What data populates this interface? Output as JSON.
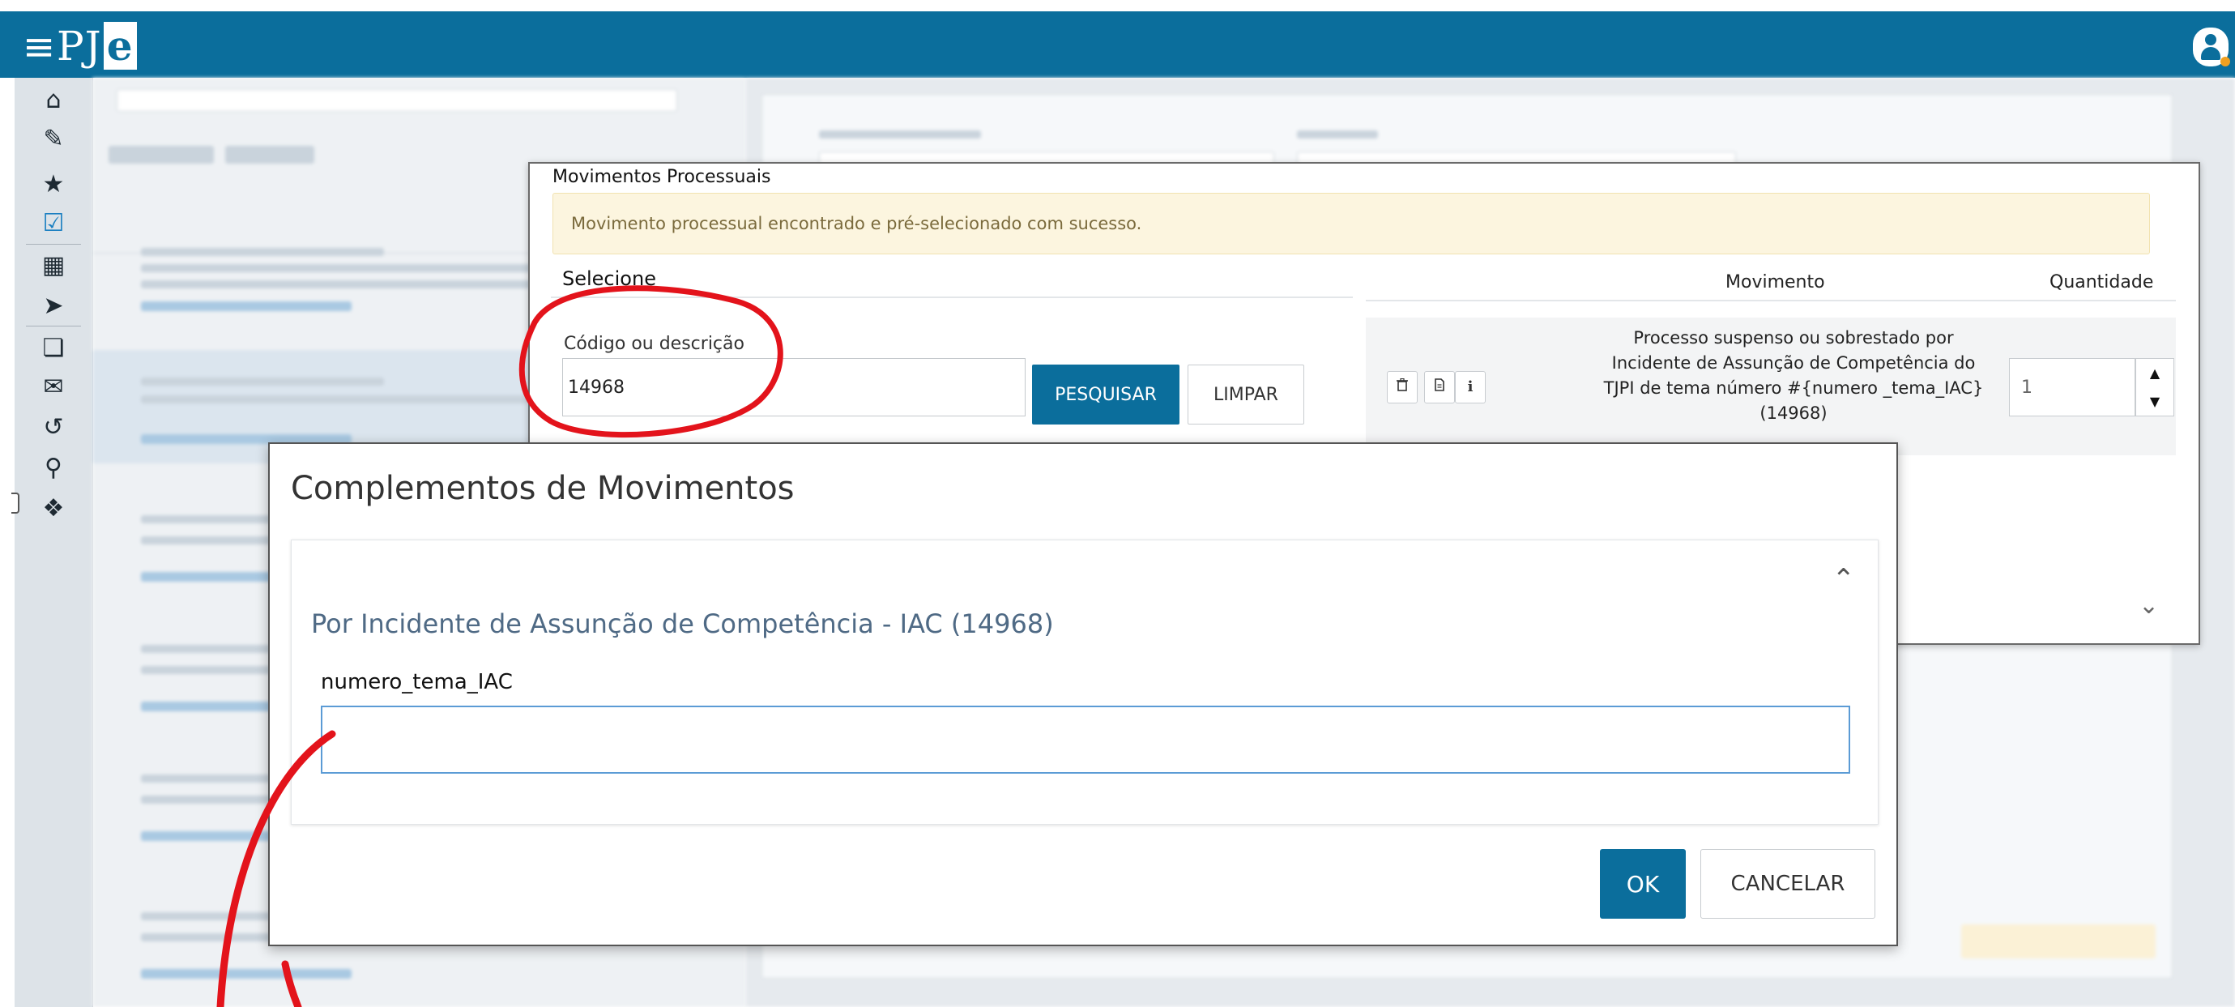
{
  "topbar": {
    "menu_icon": "hamburger-icon",
    "logo_text": "PJ",
    "logo_accent": "e",
    "user_icon": "user-icon"
  },
  "rail": {
    "icons": [
      "home-icon",
      "pencil-icon",
      "star-icon",
      "checkbox-icon",
      "calendar-icon",
      "tag-icon",
      "documents-icon",
      "envelope-icon",
      "history-icon",
      "search-icon",
      "diamond-nav-icon"
    ]
  },
  "movimentos": {
    "title": "Movimentos Processuais",
    "alert": "Movimento processual encontrado e pré-selecionado com sucesso.",
    "select_label": "Selecione",
    "code_label": "Código ou descrição",
    "code_value": "14968",
    "search_label": "PESQUISAR",
    "clear_label": "LIMPAR",
    "col_movimento": "Movimento",
    "col_quantidade": "Quantidade",
    "row": {
      "description": "Processo suspenso ou sobrestado por Incidente de Assunção de Competência do TJPI de tema número #{numero _tema_IAC} (14968)",
      "quantity": "1",
      "info_label": "i"
    }
  },
  "complementos": {
    "title": "Complementos de Movimentos",
    "subtitle": "Por Incidente de Assunção de Competência - IAC (14968)",
    "field_label": "numero_tema_IAC",
    "field_value": "",
    "ok_label": "OK",
    "cancel_label": "CANCELAR"
  },
  "colors": {
    "primary": "#0b6e9c",
    "alert_bg": "#fcf5df",
    "annotation_red": "#e3131b"
  }
}
